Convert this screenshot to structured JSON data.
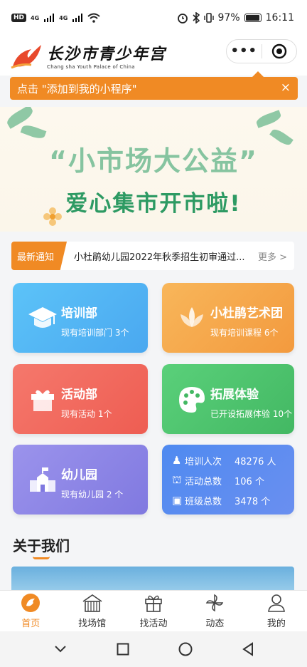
{
  "status": {
    "hd": "HD",
    "net1": "4G",
    "net2": "4G",
    "battery": "97%",
    "time": "16:11"
  },
  "header": {
    "logo_title": "长沙市青少年宫",
    "logo_subtitle": "Chang sha Youth Palace of China",
    "more_icon": "more-dots-icon",
    "target_icon": "target-icon"
  },
  "tip": {
    "text": "点击 \"添加到我的小程序\"",
    "close": "×"
  },
  "banner": {
    "line1": "“小市场大公益”",
    "line2": "爱心集市开市啦!"
  },
  "notice": {
    "tag": "最新通知",
    "text": "小杜鹃幼儿园2022年秋季招生初审通过...",
    "more": "更多 >"
  },
  "cards": [
    {
      "title": "培训部",
      "sub": "现有培训部门 3个",
      "icon": "graduation-cap-icon",
      "color": "#57b6f5"
    },
    {
      "title": "小杜鹃艺术团",
      "sub": "现有培训课程 6个",
      "icon": "lotus-icon",
      "color": "#f6a64a"
    },
    {
      "title": "活动部",
      "sub": "现有活动 1个",
      "icon": "gift-box-icon",
      "color": "#f0685e"
    },
    {
      "title": "拓展体验",
      "sub": "已开设拓展体验 10个",
      "icon": "palette-icon",
      "color": "#4fc46c"
    },
    {
      "title": "幼儿园",
      "sub": "现有幼儿园 2 个",
      "icon": "school-icon",
      "color": "#8e86e6"
    }
  ],
  "stats": [
    {
      "label": "培训人次",
      "value": "48276 人",
      "icon": "student-icon"
    },
    {
      "label": "活动总数",
      "value": "106 个",
      "icon": "activity-icon"
    },
    {
      "label": "班级总数",
      "value": "3478 个",
      "icon": "class-icon"
    }
  ],
  "about": {
    "title": "关于我们"
  },
  "tabs": [
    {
      "label": "首页",
      "icon": "home-icon"
    },
    {
      "label": "找场馆",
      "icon": "venue-icon"
    },
    {
      "label": "找活动",
      "icon": "gift-icon"
    },
    {
      "label": "动态",
      "icon": "pinwheel-icon"
    },
    {
      "label": "我的",
      "icon": "user-icon"
    }
  ],
  "colors": {
    "accent": "#f08a24"
  }
}
